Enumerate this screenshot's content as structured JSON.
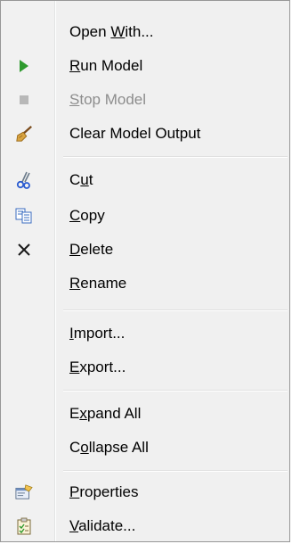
{
  "menu": {
    "items": [
      {
        "id": "open-with",
        "pre": "Open ",
        "acc": "W",
        "post": "ith...",
        "icon": "none",
        "disabled": false
      },
      {
        "id": "run-model",
        "pre": "",
        "acc": "R",
        "post": "un Model",
        "icon": "play-icon",
        "disabled": false
      },
      {
        "id": "stop-model",
        "pre": "",
        "acc": "S",
        "post": "top Model",
        "icon": "stop-icon",
        "disabled": true
      },
      {
        "id": "clear-model-output",
        "pre": "Clear Model Output",
        "acc": "",
        "post": "",
        "icon": "broom-icon",
        "disabled": false
      },
      {
        "id": "cut",
        "pre": "C",
        "acc": "u",
        "post": "t",
        "icon": "scissors-icon",
        "disabled": false
      },
      {
        "id": "copy",
        "pre": "",
        "acc": "C",
        "post": "opy",
        "icon": "copy-icon",
        "disabled": false
      },
      {
        "id": "delete",
        "pre": "",
        "acc": "D",
        "post": "elete",
        "icon": "delete-x-icon",
        "disabled": false
      },
      {
        "id": "rename",
        "pre": "",
        "acc": "R",
        "post": "ename",
        "icon": "none",
        "disabled": false
      },
      {
        "id": "import",
        "pre": "",
        "acc": "I",
        "post": "mport...",
        "icon": "none",
        "disabled": false
      },
      {
        "id": "export",
        "pre": "",
        "acc": "E",
        "post": "xport...",
        "icon": "none",
        "disabled": false
      },
      {
        "id": "expand-all",
        "pre": "E",
        "acc": "x",
        "post": "pand All",
        "icon": "none",
        "disabled": false
      },
      {
        "id": "collapse-all",
        "pre": "C",
        "acc": "o",
        "post": "llapse All",
        "icon": "none",
        "disabled": false
      },
      {
        "id": "properties",
        "pre": "",
        "acc": "P",
        "post": "roperties",
        "icon": "properties-icon",
        "disabled": false
      },
      {
        "id": "validate",
        "pre": "",
        "acc": "V",
        "post": "alidate...",
        "icon": "validate-clipboard-icon",
        "disabled": false
      }
    ]
  },
  "colors": {
    "play": "#2e9a2e",
    "stop": "#a9a9a9",
    "disabled_text": "#8d8d8d"
  }
}
